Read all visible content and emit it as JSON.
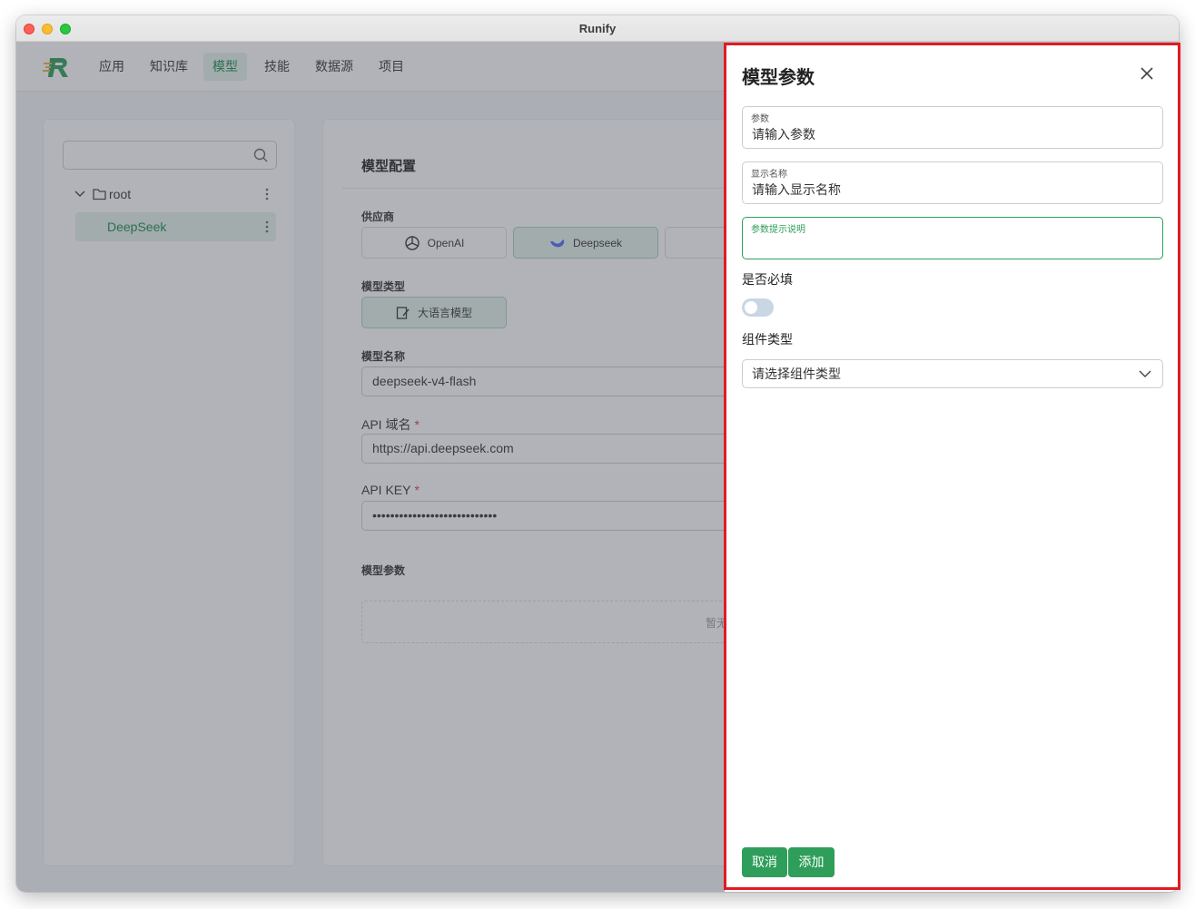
{
  "window": {
    "title": "Runify"
  },
  "nav": {
    "items": [
      {
        "label": "应用"
      },
      {
        "label": "知识库"
      },
      {
        "label": "模型",
        "active": true
      },
      {
        "label": "技能"
      },
      {
        "label": "数据源"
      },
      {
        "label": "项目"
      }
    ]
  },
  "tree": {
    "search_placeholder": "",
    "root_label": "root",
    "child_label": "DeepSeek"
  },
  "config": {
    "title": "模型配置",
    "provider_label": "供应商",
    "providers": [
      {
        "label": "OpenAI"
      },
      {
        "label": "Deepseek",
        "active": true
      }
    ],
    "model_type_label": "模型类型",
    "model_type_value": "大语言模型",
    "model_name_label": "模型名称",
    "model_name_value": "deepseek-v4-flash",
    "api_domain_label": "API 域名",
    "api_domain_value": "https://api.deepseek.com",
    "api_key_label": "API KEY",
    "api_key_value": "••••••••••••••••••••••••••••",
    "params_label": "模型参数",
    "empty_text": "暂无"
  },
  "drawer": {
    "title": "模型参数",
    "param": {
      "label": "参数",
      "placeholder": "请输入参数"
    },
    "display_name": {
      "label": "显示名称",
      "placeholder": "请输入显示名称"
    },
    "hint": {
      "label": "参数提示说明",
      "placeholder": ""
    },
    "required_label": "是否必填",
    "required_on": false,
    "component_type_label": "组件类型",
    "component_type_placeholder": "请选择组件类型",
    "cancel_label": "取消",
    "add_label": "添加"
  },
  "colors": {
    "accent": "#2f9e5a",
    "active_bg": "#e6f3ec",
    "highlight_frame": "#e11b22"
  }
}
